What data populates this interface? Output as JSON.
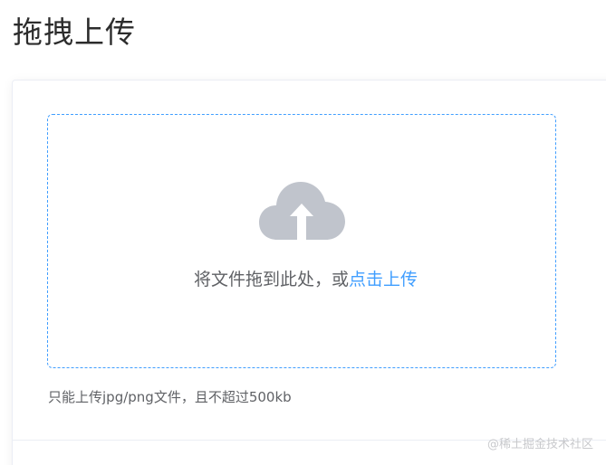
{
  "page": {
    "title": "拖拽上传"
  },
  "upload": {
    "icon": "upload-cloud-icon",
    "drag_text": "将文件拖到此处，或",
    "click_text": "点击上传",
    "tip": "只能上传jpg/png文件，且不超过500kb"
  },
  "watermark": {
    "text": "@稀土掘金技术社区"
  },
  "colors": {
    "accent": "#409eff",
    "icon": "#c0c4cc",
    "text": "#606266",
    "border": "#ebeef5"
  }
}
